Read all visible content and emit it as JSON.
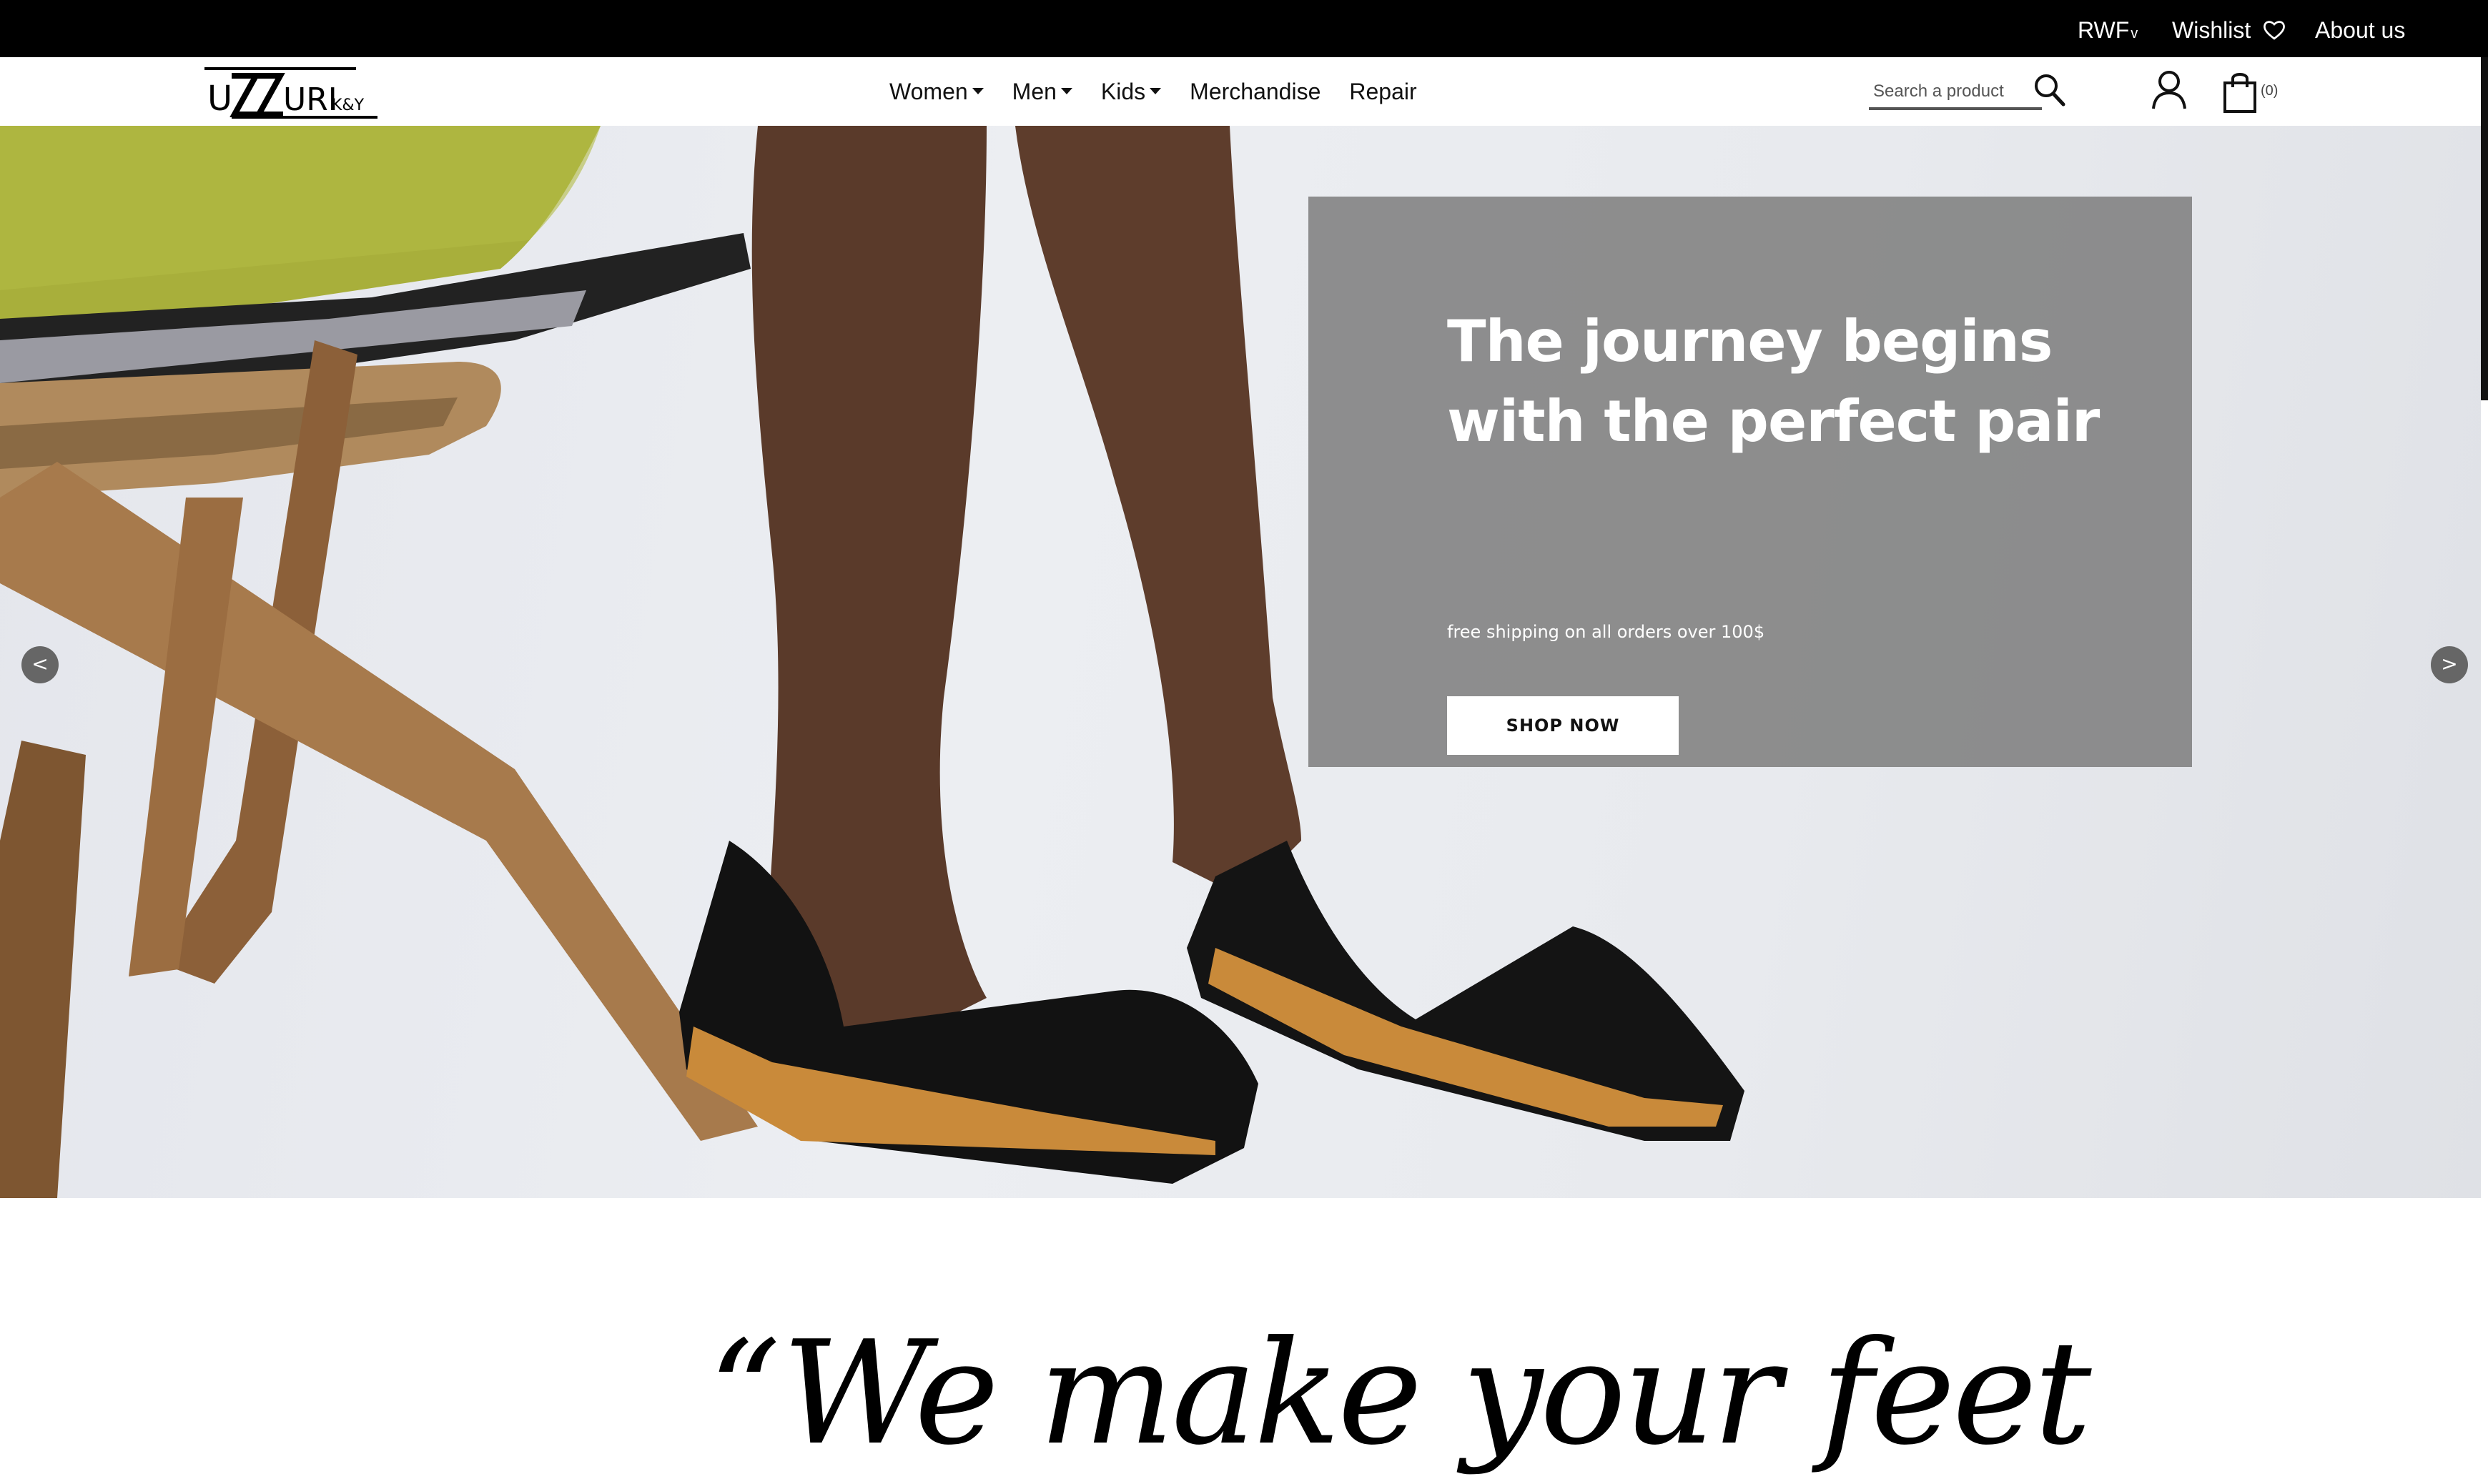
{
  "topbar": {
    "currency": "RWF",
    "currency_chevron": "v",
    "wishlist": "Wishlist",
    "wishlist_icon": "heart-icon",
    "about": "About us"
  },
  "logo": {
    "text_main": "UZZURI",
    "text_sub": "K&Y"
  },
  "nav": {
    "women": "Women",
    "men": "Men",
    "kids": "Kids",
    "merchandise": "Merchandise",
    "repair": "Repair"
  },
  "search": {
    "placeholder": "Search a product",
    "icon": "search-icon"
  },
  "account": {
    "icon": "user-icon"
  },
  "cart": {
    "icon": "shopping-bag-icon",
    "count": "(0)"
  },
  "hero": {
    "title": "The journey begins with the perfect pair",
    "subtitle": "free shipping on all orders over 100$",
    "button": "SHOP NOW",
    "prev_label": "<",
    "next_label": ">"
  },
  "quote": {
    "text": "“We make your feet"
  },
  "colors": {
    "topbar_bg": "#000000",
    "overlay": "#808080",
    "skirt": "#a9b03a",
    "wood": "#8b5e34",
    "sandal": "#111111"
  }
}
